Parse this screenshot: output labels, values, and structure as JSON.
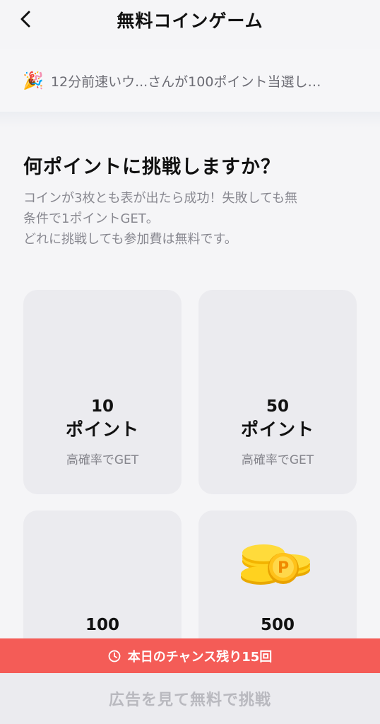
{
  "header": {
    "title": "無料コインゲーム",
    "back_icon": "chevron-left-icon"
  },
  "ticker": {
    "icon": "party-popper-icon",
    "emoji": "🎉",
    "message": "12分前速いウ...さんが100ポイント当選し…"
  },
  "intro": {
    "heading": "何ポイントに挑戦しますか？",
    "line1": "コインが3枚とも表が出たら成功！失敗しても無",
    "line2": "条件で1ポイントGET。",
    "line3": "どれに挑戦しても参加費は無料です。"
  },
  "options": [
    {
      "points": "10",
      "unit": "ポイント",
      "note": "高確率でGET"
    },
    {
      "points": "50",
      "unit": "ポイント",
      "note": "高確率でGET"
    },
    {
      "points": "100"
    },
    {
      "points": "500",
      "image": "gold-p-coins-icon"
    }
  ],
  "banner": {
    "icon": "clock-icon",
    "text": "本日のチャンス残り15回",
    "color": "#f45c57"
  },
  "cta": {
    "label": "広告を見て無料で挑戦"
  }
}
